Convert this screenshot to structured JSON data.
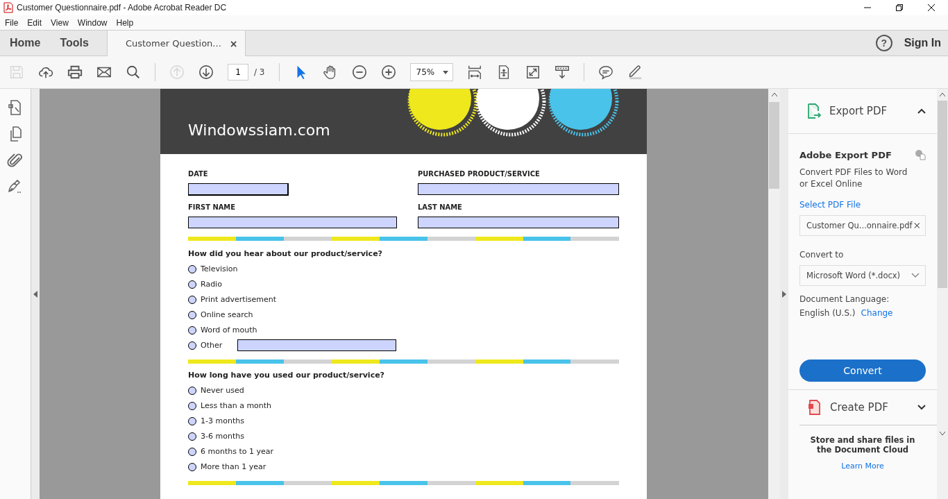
{
  "window": {
    "title": "Customer Questionnaire.pdf - Adobe Acrobat Reader DC"
  },
  "menu": [
    "File",
    "Edit",
    "View",
    "Window",
    "Help"
  ],
  "nav_tabs": [
    {
      "label": "Home",
      "selected": false
    },
    {
      "label": "Tools",
      "selected": false
    }
  ],
  "doc_tab": {
    "label": "Customer Question...",
    "close": "×",
    "selected": true
  },
  "help": "?",
  "sign_in": "Sign In",
  "toolbar": [
    {
      "kind": "save",
      "disabled": true
    },
    {
      "kind": "upload",
      "disabled": false
    },
    {
      "kind": "print",
      "disabled": false
    },
    {
      "kind": "mail",
      "disabled": false
    },
    {
      "kind": "search",
      "disabled": false
    },
    {
      "kind": "sep"
    },
    {
      "kind": "up",
      "disabled": true
    },
    {
      "kind": "down",
      "disabled": false
    }
  ],
  "page_field": {
    "value": "1",
    "total": "/ 3"
  },
  "zoom": {
    "value": "75%"
  },
  "document": {
    "brand": "Windowssiam.com",
    "fields": [
      {
        "label": "DATE"
      },
      {
        "label": "PURCHASED PRODUCT/SERVICE"
      },
      {
        "label": "FIRST NAME"
      },
      {
        "label": "LAST NAME"
      }
    ],
    "questions": [
      {
        "text": "How did you hear about our product/service?",
        "options": [
          {
            "label": "Television",
            "selected": false,
            "kind": "radio"
          },
          {
            "label": "Radio",
            "selected": false,
            "kind": "radio"
          },
          {
            "label": "Print advertisement",
            "selected": false,
            "kind": "radio"
          },
          {
            "label": "Online search",
            "selected": false,
            "kind": "radio"
          },
          {
            "label": "Word of mouth",
            "selected": false,
            "kind": "radio"
          },
          {
            "label": "Other",
            "selected": false,
            "kind": "radio_text"
          }
        ]
      },
      {
        "text": "How long have you used our product/service?",
        "options": [
          {
            "label": "Never used",
            "selected": false,
            "kind": "radio"
          },
          {
            "label": "Less than a month",
            "selected": false,
            "kind": "radio"
          },
          {
            "label": "1-3 months",
            "selected": false,
            "kind": "radio"
          },
          {
            "label": "3-6 months",
            "selected": false,
            "kind": "radio"
          },
          {
            "label": "6 months to 1 year",
            "selected": false,
            "kind": "radio"
          },
          {
            "label": "More than 1 year",
            "selected": false,
            "kind": "radio"
          }
        ]
      }
    ]
  },
  "panel": {
    "title": "Export PDF",
    "section_title": "Adobe Export PDF",
    "description": "Convert PDF Files to Word or Excel Online",
    "select_link": "Select PDF File",
    "file": "Customer Qu...onnaire.pdf",
    "convert_label": "Convert to",
    "format": "Microsoft Word (*.docx)",
    "language_label": "Document Language:",
    "language": "English (U.S.)",
    "change_link": "Change",
    "convert_button": "Convert",
    "create_title": "Create PDF",
    "cloud_text": "Store and share files in the Document Cloud",
    "learn_more": "Learn More"
  }
}
